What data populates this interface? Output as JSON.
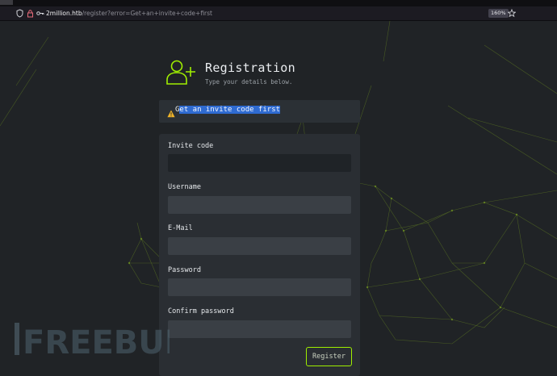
{
  "browser": {
    "url_host": "2million.htb",
    "url_path": "/register?error=Get+an+invite+code+first",
    "zoom": "160%"
  },
  "header": {
    "title": "Registration",
    "subtitle": "Type your details below."
  },
  "alert": {
    "first_char": "G",
    "highlighted": "et an invite code first"
  },
  "form": {
    "fields": [
      {
        "label": "Invite code",
        "value": ""
      },
      {
        "label": "Username",
        "value": ""
      },
      {
        "label": "E-Mail",
        "value": ""
      },
      {
        "label": "Password",
        "value": ""
      },
      {
        "label": "Confirm password",
        "value": ""
      }
    ],
    "submit_label": "Register"
  },
  "watermark": {
    "text": "FREEBUF"
  },
  "colors": {
    "accent": "#9fef00",
    "background": "#202326",
    "card": "#2a2e33",
    "selection": "#2f6bd1"
  }
}
